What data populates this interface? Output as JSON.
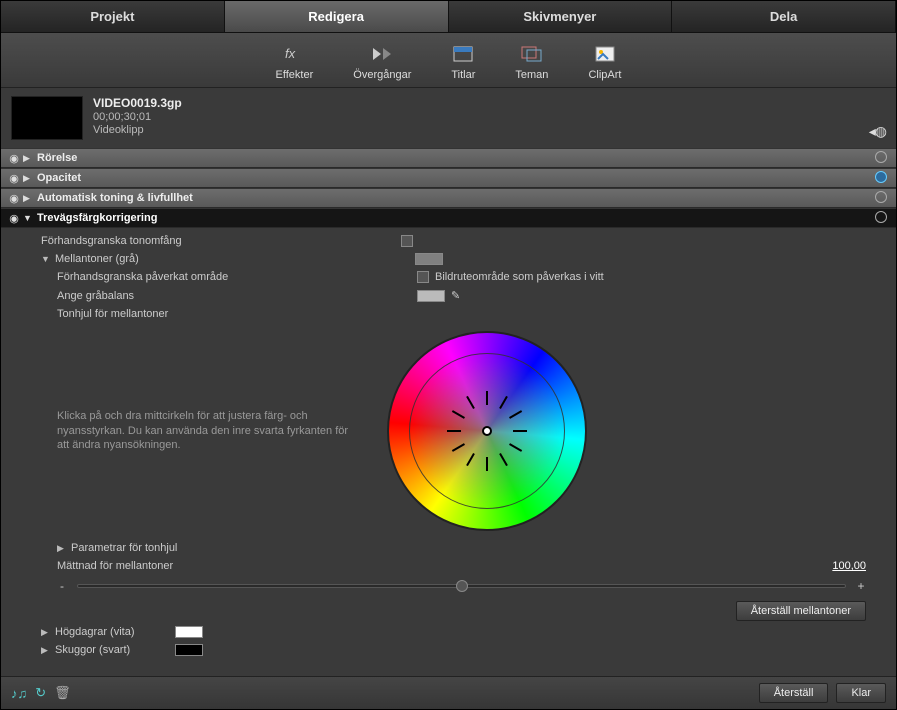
{
  "tabs": {
    "project": "Projekt",
    "edit": "Redigera",
    "menus": "Skivmenyer",
    "share": "Dela"
  },
  "toolbar": {
    "effects": "Effekter",
    "transitions": "Övergångar",
    "titles": "Titlar",
    "themes": "Teman",
    "clipart": "ClipArt"
  },
  "clip": {
    "name": "VIDEO0019.3gp",
    "tc": "00;00;30;01",
    "type": "Videoklipp"
  },
  "rows": {
    "motion": "Rörelse",
    "opacity": "Opacitet",
    "auto": "Automatisk toning & livfullhet",
    "three": "Trevägsfärgkorrigering"
  },
  "panel": {
    "preview_range": "Förhandsgranska tonomfång",
    "midtones": "Mellantoner (grå)",
    "preview_affected": "Förhandsgranska påverkat område",
    "frame_white": "Bildruteområde som påverkas i vitt",
    "gray_balance": "Ange gråbalans",
    "wheel_mid": "Tonhjul för mellantoner",
    "wheel_help": "Klicka på och dra mittcirkeln för att justera färg- och nyansstyrkan. Du kan använda den inre svarta fyrkanten för att ändra nyansökningen.",
    "params": "Parametrar för tonhjul",
    "saturation": "Mättnad för mellantoner",
    "sat_value": "100,00",
    "reset_mid": "Återställ mellantoner",
    "highlights": "Högdagrar (vita)",
    "shadows": "Skuggor (svart)"
  },
  "footer": {
    "reset": "Återställ",
    "done": "Klar"
  }
}
